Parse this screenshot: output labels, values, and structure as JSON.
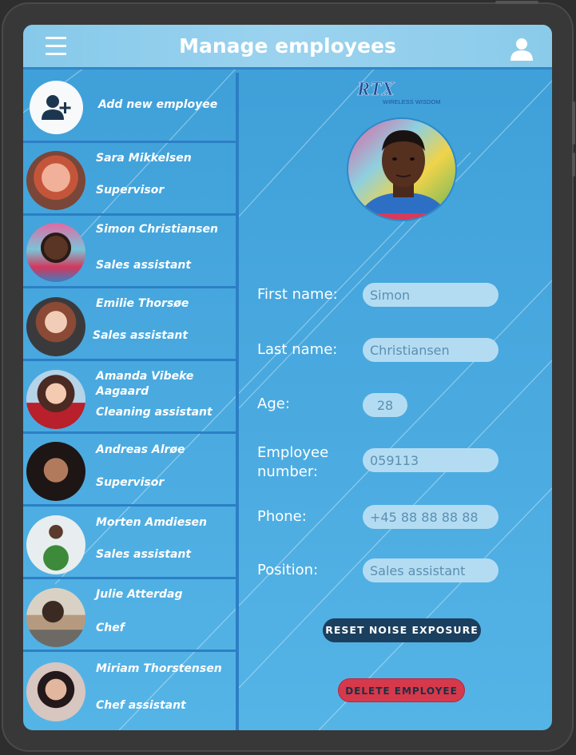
{
  "header": {
    "title": "Manage employees",
    "menu_icon": "hamburger-menu-icon",
    "user_icon": "user-account-icon"
  },
  "sidebar": {
    "add_label": "Add new employee",
    "employees": [
      {
        "name": "Sara Mikkelsen",
        "position": "Supervisor"
      },
      {
        "name": "Simon Christiansen",
        "position": "Sales assistant"
      },
      {
        "name": "Emilie Thorsøe",
        "position": "Sales assistant"
      },
      {
        "name": "Amanda Vibeke Aagaard",
        "position": "Cleaning assistant"
      },
      {
        "name": "Andreas Alrøe",
        "position": "Supervisor"
      },
      {
        "name": "Morten Amdiesen",
        "position": "Sales assistant"
      },
      {
        "name": "Julie Atterdag",
        "position": "Chef"
      },
      {
        "name": "Miriam Thorstensen",
        "position": "Chef assistant"
      }
    ]
  },
  "logo": {
    "brand": "RTX",
    "tagline": "WIRELESS WISDOM"
  },
  "form": {
    "first_name_label": "First name:",
    "first_name": "Simon",
    "last_name_label": "Last name:",
    "last_name": "Christiansen",
    "age_label": "Age:",
    "age": "28",
    "employee_number_label": "Employee number:",
    "employee_number": "059113",
    "phone_label": "Phone:",
    "phone": "+45 88 88 88 88",
    "position_label": "Position:",
    "position": "Sales assistant"
  },
  "buttons": {
    "reset": "RESET NOISE EXPOSURE",
    "delete": "DELETE EMPLOYEE"
  },
  "colors": {
    "header": "#9bd3ef",
    "panel": "#4aaae0",
    "divider": "#2c7fc4",
    "reset": "#1b3f5e",
    "delete": "#d5394b"
  }
}
